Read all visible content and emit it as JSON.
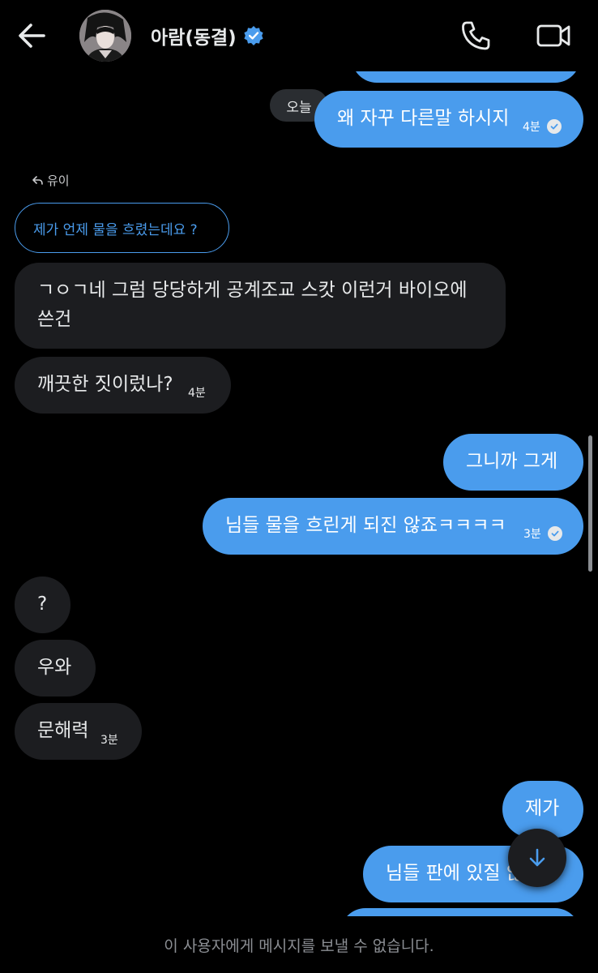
{
  "header": {
    "title": "아람(동결)"
  },
  "date_chip": "오늘",
  "messages": [
    {
      "text": "왜 자꾸 다른말 하시지",
      "time": "4분"
    },
    {
      "reply_to": "유이",
      "quote": "제가 언제 물을 흐렸는데요 ?"
    },
    {
      "line1": "ㄱㅇㄱ네 그럼 당당하게 공계조교 스캇 이런거 바이오에",
      "line2": "쓴건"
    },
    {
      "text": "깨끗한 짓이렀나?",
      "time": "4분"
    },
    {
      "text": "그니까 그게"
    },
    {
      "text": "님들 물을 흐린게 되진 않죠ㅋㅋㅋㅋ",
      "time": "3분"
    },
    {
      "text": "?"
    },
    {
      "text": "우와"
    },
    {
      "text": "문해력",
      "time": "3분"
    },
    {
      "text": "제가"
    },
    {
      "text": "님들 판에 있질 않는데"
    }
  ],
  "footer": {
    "notice": "이 사용자에게 메시지를 보낼 수 없습니다."
  },
  "colors": {
    "accent": "#4a9ced",
    "incoming": "#1c1d20",
    "background": "#000000"
  },
  "icons": [
    "back-arrow-icon",
    "verified-badge-icon",
    "phone-icon",
    "video-camera-icon",
    "reply-icon",
    "read-check-icon",
    "arrow-down-icon"
  ]
}
